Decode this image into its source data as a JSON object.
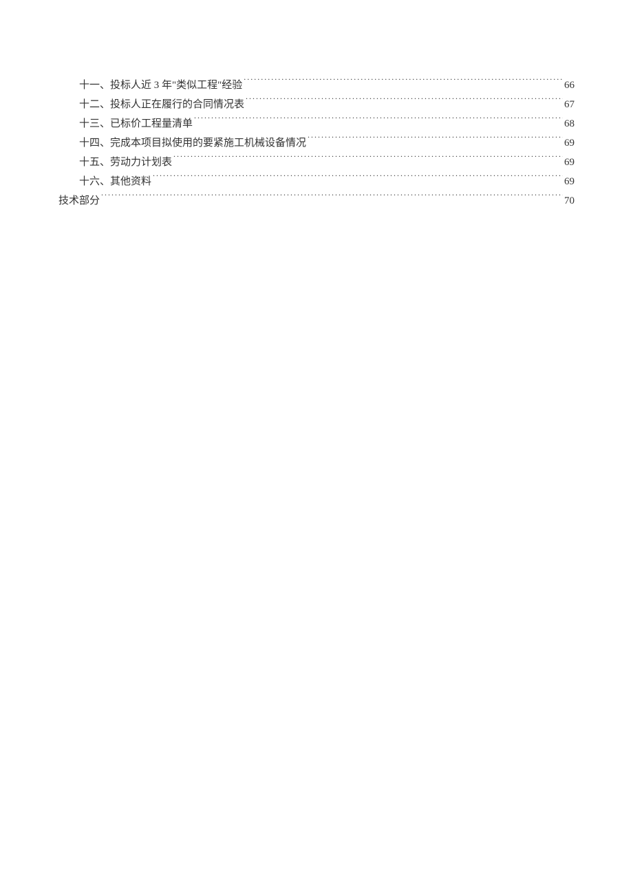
{
  "toc": [
    {
      "level": 2,
      "title": "十一、投标人近 3 年\"类似工程\"经验",
      "page": "66"
    },
    {
      "level": 2,
      "title": "十二、投标人正在履行的合同情况表",
      "page": "67"
    },
    {
      "level": 2,
      "title": "十三、已标价工程量清单",
      "page": "68"
    },
    {
      "level": 2,
      "title": "十四、完成本项目拟使用的要紧施工机械设备情况",
      "page": "69"
    },
    {
      "level": 2,
      "title": "十五、劳动力计划表",
      "page": "69"
    },
    {
      "level": 2,
      "title": "十六、其他资料",
      "page": "69"
    },
    {
      "level": 1,
      "title": "技术部分",
      "page": "70"
    }
  ]
}
